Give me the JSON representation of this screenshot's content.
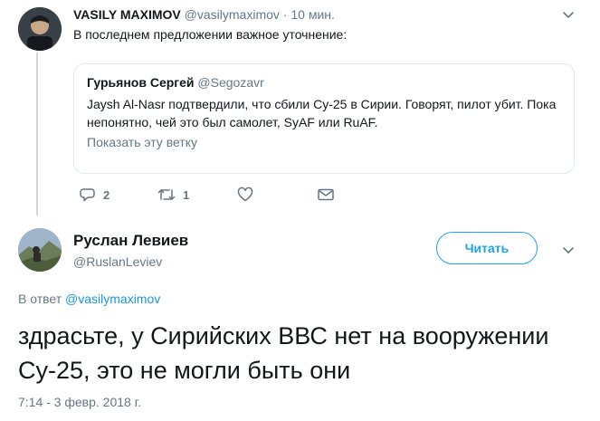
{
  "tweet1": {
    "name": "VASILY MAXIMOV",
    "handle": "@vasilymaximov",
    "separator": "·",
    "time": "10 мин.",
    "text": "В последнем предложении важное уточнение:",
    "quote": {
      "name": "Гурьянов Сергей",
      "handle": "@Segozavr",
      "text": "Jaysh Al-Nasr подтвердили, что сбили Су-25 в Сирии. Говорят, пилот убит. Пока непонятно, чей это был самолет, SyAF или RuAF.",
      "show_thread": "Показать эту ветку"
    },
    "actions": {
      "reply_icon": "reply-icon",
      "reply_count": "2",
      "retweet_icon": "retweet-icon",
      "retweet_count": "1",
      "like_icon": "heart-icon",
      "dm_icon": "envelope-icon"
    }
  },
  "tweet2": {
    "name": "Руслан Левиев",
    "handle": "@RuslanLeviev",
    "follow_label": "Читать",
    "reply_prefix": "В ответ",
    "reply_to": "@vasilymaximov",
    "text": "здрасьте, у Сирийских ВВС нет на вооружении Су-25, это не могли быть они",
    "timestamp": "7:14 - 3 февр. 2018 г."
  },
  "colors": {
    "accent": "#1da1f2",
    "link": "#1b95e0",
    "muted": "#657786",
    "border": "#e1e8ed"
  }
}
